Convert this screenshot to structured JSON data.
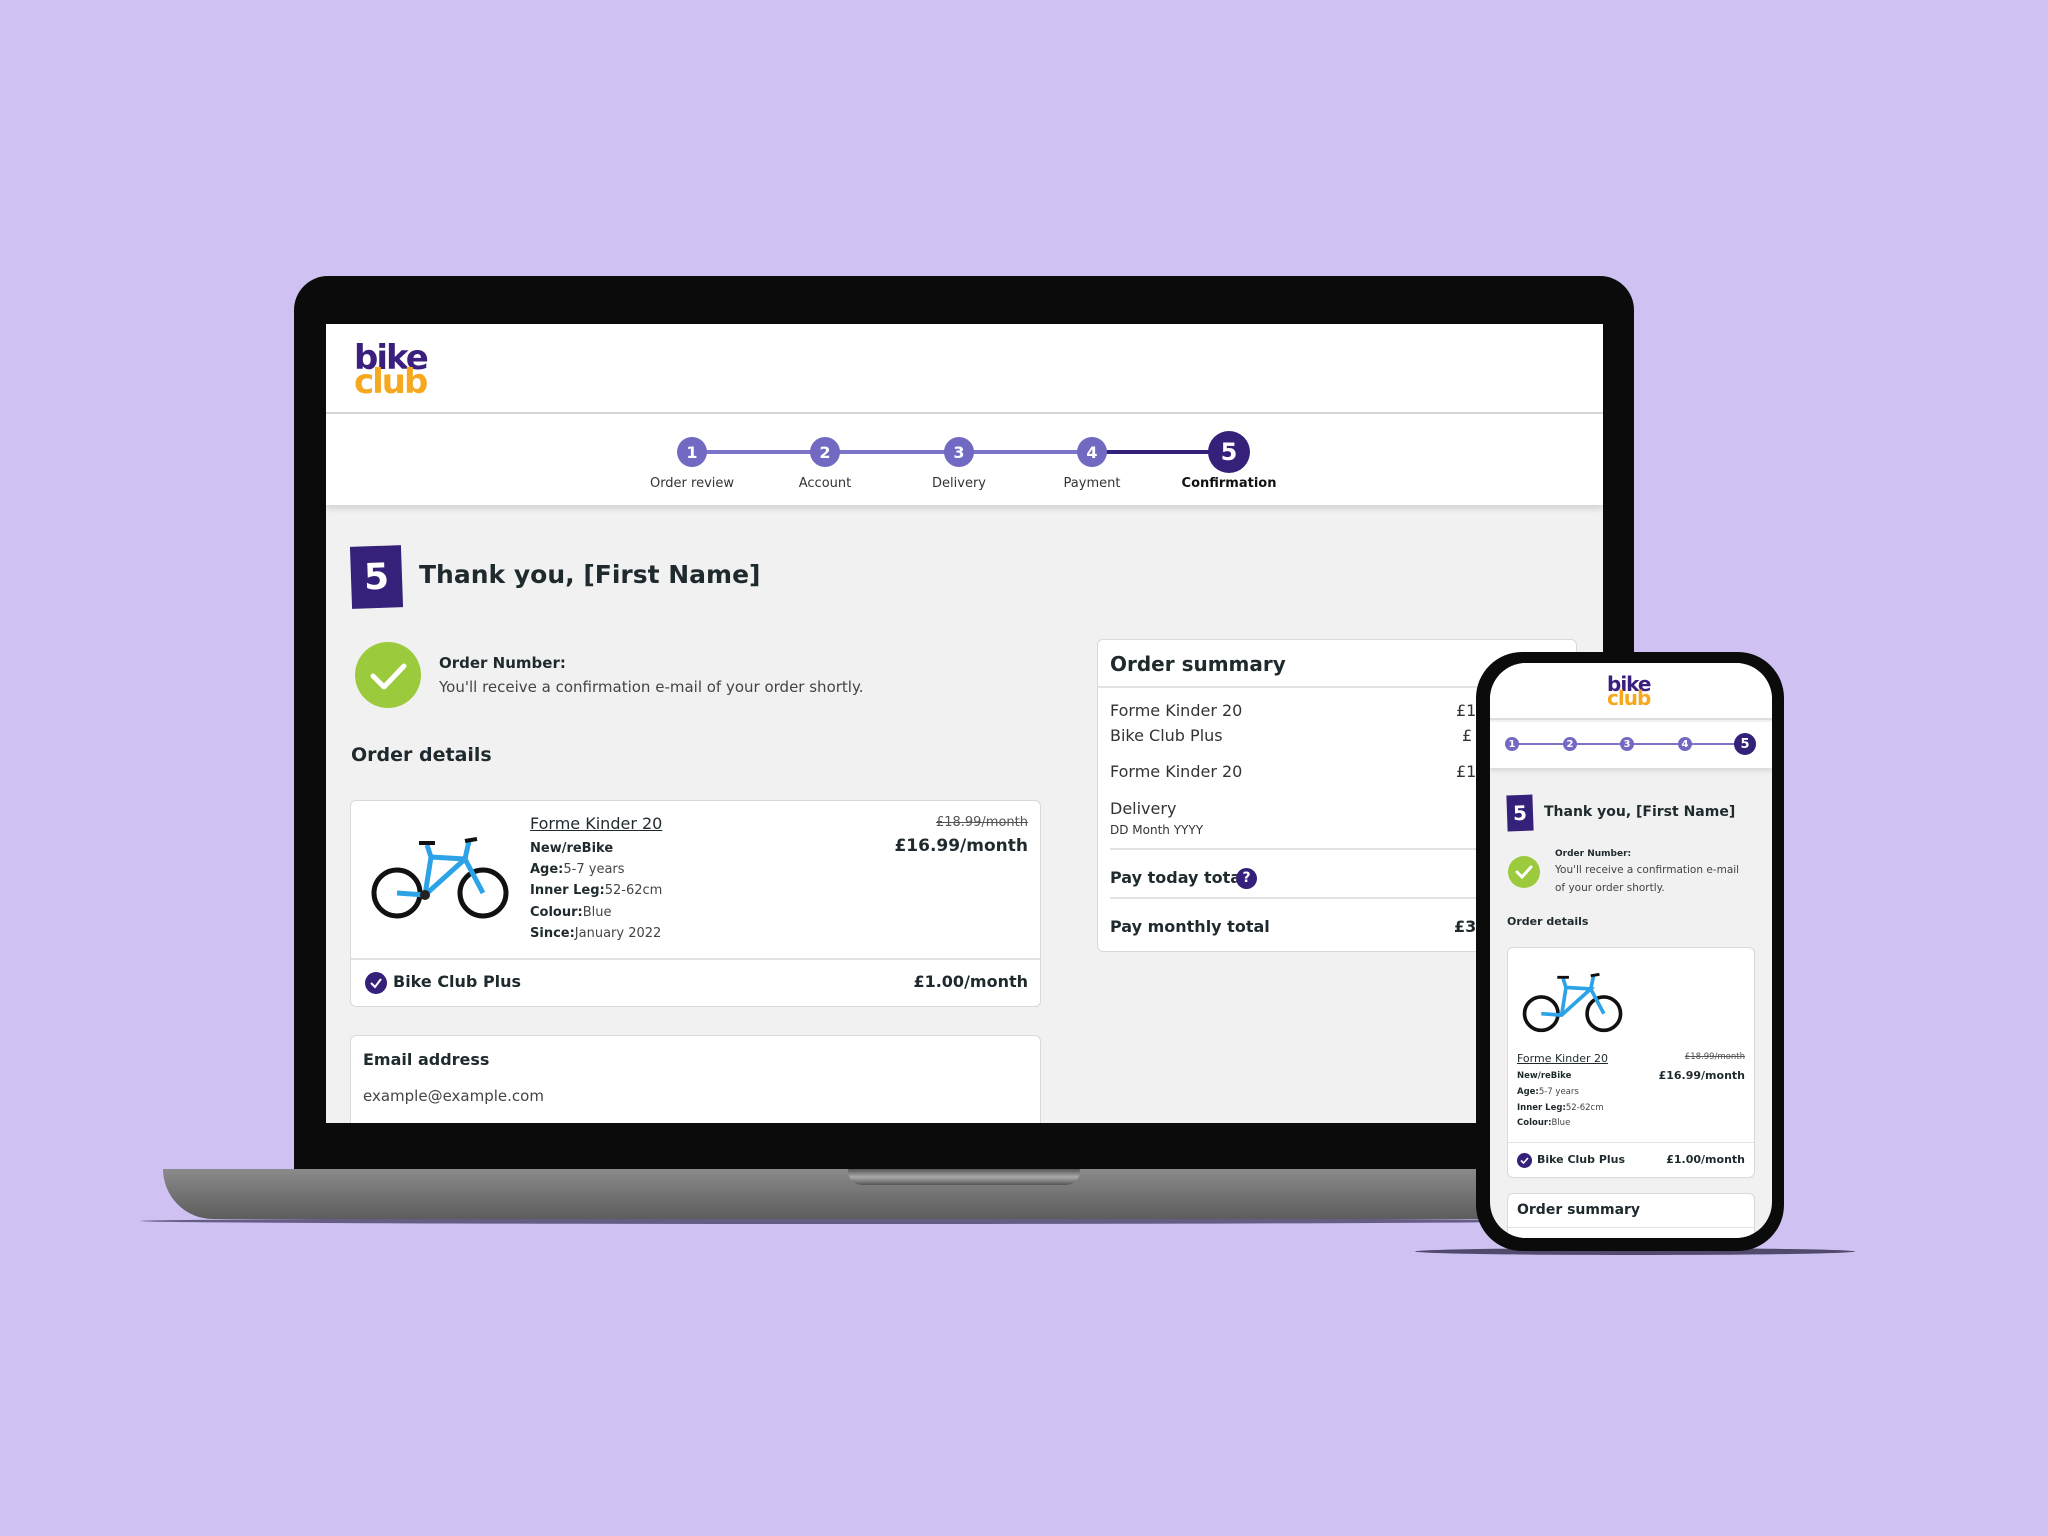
{
  "brand": {
    "logo_top": "bike",
    "logo_bottom": "club",
    "colors": {
      "purple": "#35207a",
      "orange": "#f6a81f",
      "step": "#7169c2",
      "success": "#9bcb3c",
      "background": "#cfc2f2"
    }
  },
  "stepper": {
    "steps": [
      {
        "n": "1",
        "label": "Order review"
      },
      {
        "n": "2",
        "label": "Account"
      },
      {
        "n": "3",
        "label": "Delivery"
      },
      {
        "n": "4",
        "label": "Payment"
      },
      {
        "n": "5",
        "label": "Confirmation"
      }
    ],
    "current": 5
  },
  "confirmation": {
    "step_badge": "5",
    "title": "Thank you, [First Name]",
    "order_number_label": "Order Number:",
    "message": "You'll receive a confirmation e-mail of your order shortly.",
    "message_line1": "You'll receive a confirmation e-mail",
    "message_line2": "of your order shortly."
  },
  "order_details": {
    "heading": "Order details",
    "product": {
      "name": "Forme Kinder 20",
      "condition": "New/reBike",
      "age_label": "Age:",
      "age": "5-7 years",
      "leg_label": "Inner Leg:",
      "leg": "52-62cm",
      "colour_label": "Colour:",
      "colour": "Blue",
      "since_label": "Since:",
      "since": "January 2022",
      "old_price": "£18.99/month",
      "price": "£16.99/month"
    },
    "addon": {
      "name": "Bike Club Plus",
      "price": "£1.00/month"
    }
  },
  "email": {
    "label": "Email address",
    "value": "example@example.com"
  },
  "summary": {
    "heading": "Order summary",
    "rows": [
      {
        "label": "Forme Kinder 20",
        "value": "£1"
      },
      {
        "label": "Bike Club Plus",
        "value": "£"
      },
      {
        "label": "Forme Kinder 20",
        "value": "£1"
      }
    ],
    "delivery_label": "Delivery",
    "delivery_date": "DD Month YYYY",
    "pay_today_label": "Pay today total",
    "pay_monthly_label": "Pay monthly total",
    "pay_monthly_value": "£3"
  }
}
